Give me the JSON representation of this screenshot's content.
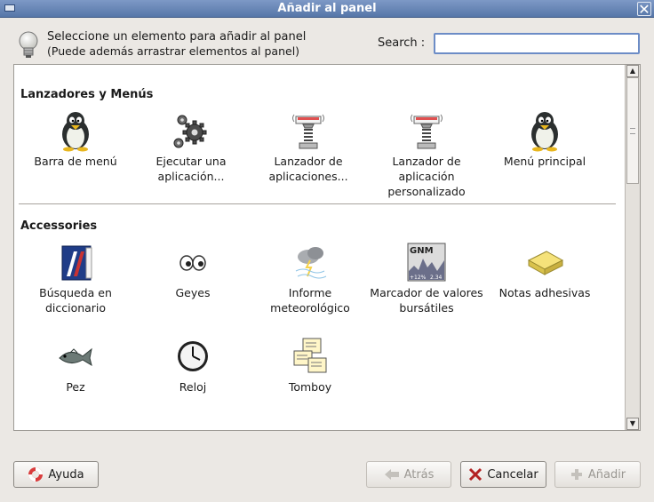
{
  "window": {
    "title": "Añadir al panel",
    "close_glyph": "✕"
  },
  "header": {
    "hint_line1": "Seleccione un elemento para añadir al panel",
    "hint_line2": "(Puede además arrastrar elementos al panel)",
    "search_label": "Search :",
    "search_value": ""
  },
  "sections": [
    {
      "title": "Lanzadores y Menús",
      "items": [
        {
          "label": "Barra de menú",
          "icon": "penguin-icon"
        },
        {
          "label": "Ejecutar una aplicación...",
          "icon": "gears-icon"
        },
        {
          "label": "Lanzador de aplicaciones...",
          "icon": "launcher-icon"
        },
        {
          "label": "Lanzador de aplicación personalizado",
          "icon": "launcher-icon"
        },
        {
          "label": "Menú principal",
          "icon": "penguin-icon"
        }
      ]
    },
    {
      "title": "Accessories",
      "items": [
        {
          "label": "Búsqueda en diccionario",
          "icon": "dictionary-icon"
        },
        {
          "label": "Geyes",
          "icon": "eyes-icon"
        },
        {
          "label": "Informe meteorológico",
          "icon": "weather-icon"
        },
        {
          "label": "Marcador de valores bursátiles",
          "icon": "stock-ticker-icon"
        },
        {
          "label": "Notas adhesivas",
          "icon": "sticky-notes-icon"
        },
        {
          "label": "Pez",
          "icon": "fish-icon"
        },
        {
          "label": "Reloj",
          "icon": "clock-icon"
        },
        {
          "label": "Tomboy",
          "icon": "tomboy-icon"
        }
      ]
    }
  ],
  "stock_icon": {
    "title": "GNM",
    "change": "+12%",
    "value": "2.34"
  },
  "buttons": {
    "help": "Ayuda",
    "back": "Atrás",
    "cancel": "Cancelar",
    "add": "Añadir"
  }
}
